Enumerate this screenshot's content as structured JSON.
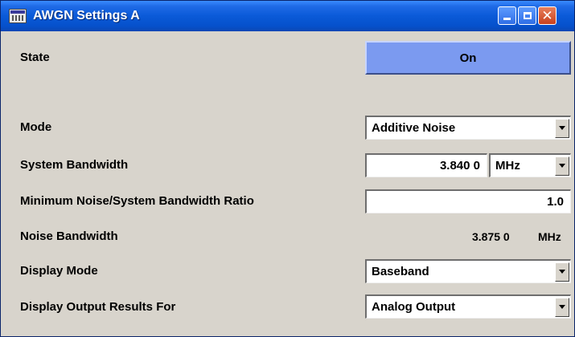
{
  "window": {
    "title": "AWGN Settings A",
    "buttons": {
      "minimize": "minimize-icon",
      "maximize": "maximize-icon",
      "close": "close-icon"
    }
  },
  "rows": {
    "state": {
      "label": "State",
      "value": "On"
    },
    "mode": {
      "label": "Mode",
      "value": "Additive Noise"
    },
    "system_bandwidth": {
      "label": "System Bandwidth",
      "value": "3.840 0",
      "unit": "MHz"
    },
    "min_ratio": {
      "label": "Minimum Noise/System Bandwidth Ratio",
      "value": "1.0"
    },
    "noise_bandwidth": {
      "label": "Noise Bandwidth",
      "value": "3.875 0",
      "unit": "MHz"
    },
    "display_mode": {
      "label": "Display Mode",
      "value": "Baseband"
    },
    "display_output": {
      "label": "Display Output Results For",
      "value": "Analog Output"
    }
  },
  "colors": {
    "titlebar": "#0a5ad8",
    "state_on": "#7b9af0",
    "panel": "#d8d4cc"
  }
}
